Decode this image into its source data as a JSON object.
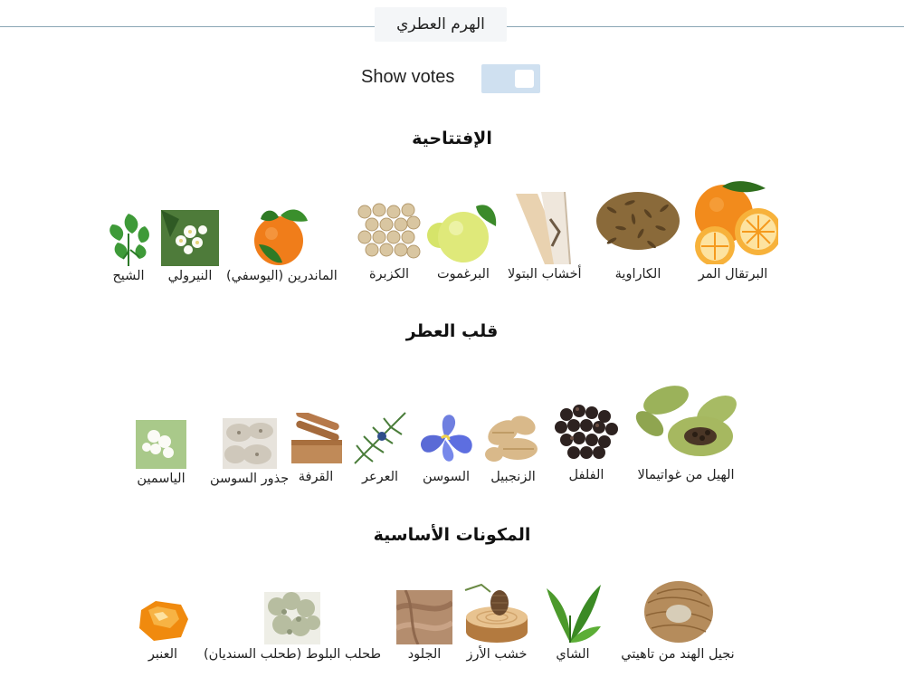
{
  "header": {
    "title": "الهرم العطري"
  },
  "votes": {
    "label": "Show votes"
  },
  "sections": [
    {
      "title": "الإفتتاحية",
      "notes": [
        {
          "label": "البرتقال المر",
          "icon": "bitter-orange-icon"
        },
        {
          "label": "الكاراوية",
          "icon": "caraway-icon"
        },
        {
          "label": "أخشاب البتولا",
          "icon": "birch-wood-icon"
        },
        {
          "label": "البرغموت",
          "icon": "bergamot-icon"
        },
        {
          "label": "الكزبرة",
          "icon": "coriander-icon"
        },
        {
          "label": "الماندرين (اليوسفي)",
          "icon": "mandarin-icon"
        },
        {
          "label": "النيرولي",
          "icon": "neroli-icon"
        },
        {
          "label": "الشيح",
          "icon": "wormwood-icon"
        }
      ]
    },
    {
      "title": "قلب العطر",
      "notes": [
        {
          "label": "الهيل من غواتيمالا",
          "icon": "cardamom-icon"
        },
        {
          "label": "الفلفل",
          "icon": "pepper-icon"
        },
        {
          "label": "الزنجبيل",
          "icon": "ginger-icon"
        },
        {
          "label": "السوسن",
          "icon": "iris-icon"
        },
        {
          "label": "العرعر",
          "icon": "juniper-icon"
        },
        {
          "label": "القرفة",
          "icon": "cinnamon-icon"
        },
        {
          "label": "جذور السوسن",
          "icon": "orris-root-icon"
        },
        {
          "label": "الياسمين",
          "icon": "jasmine-icon"
        }
      ]
    },
    {
      "title": "المكونات الأساسية",
      "notes": [
        {
          "label": "نجيل الهند من تاهيتي",
          "icon": "vetiver-icon"
        },
        {
          "label": "الشاي",
          "icon": "tea-icon"
        },
        {
          "label": "خشب الأرز",
          "icon": "cedarwood-icon"
        },
        {
          "label": "الجلود",
          "icon": "leather-icon"
        },
        {
          "label": "طحلب البلوط (طحلب السنديان)",
          "icon": "oakmoss-icon"
        },
        {
          "label": "العنبر",
          "icon": "amber-icon"
        }
      ]
    }
  ],
  "colors": {
    "rule": "#8aa6b5",
    "toggle": "#cfe0f0",
    "title_box": "#f4f6f8"
  }
}
